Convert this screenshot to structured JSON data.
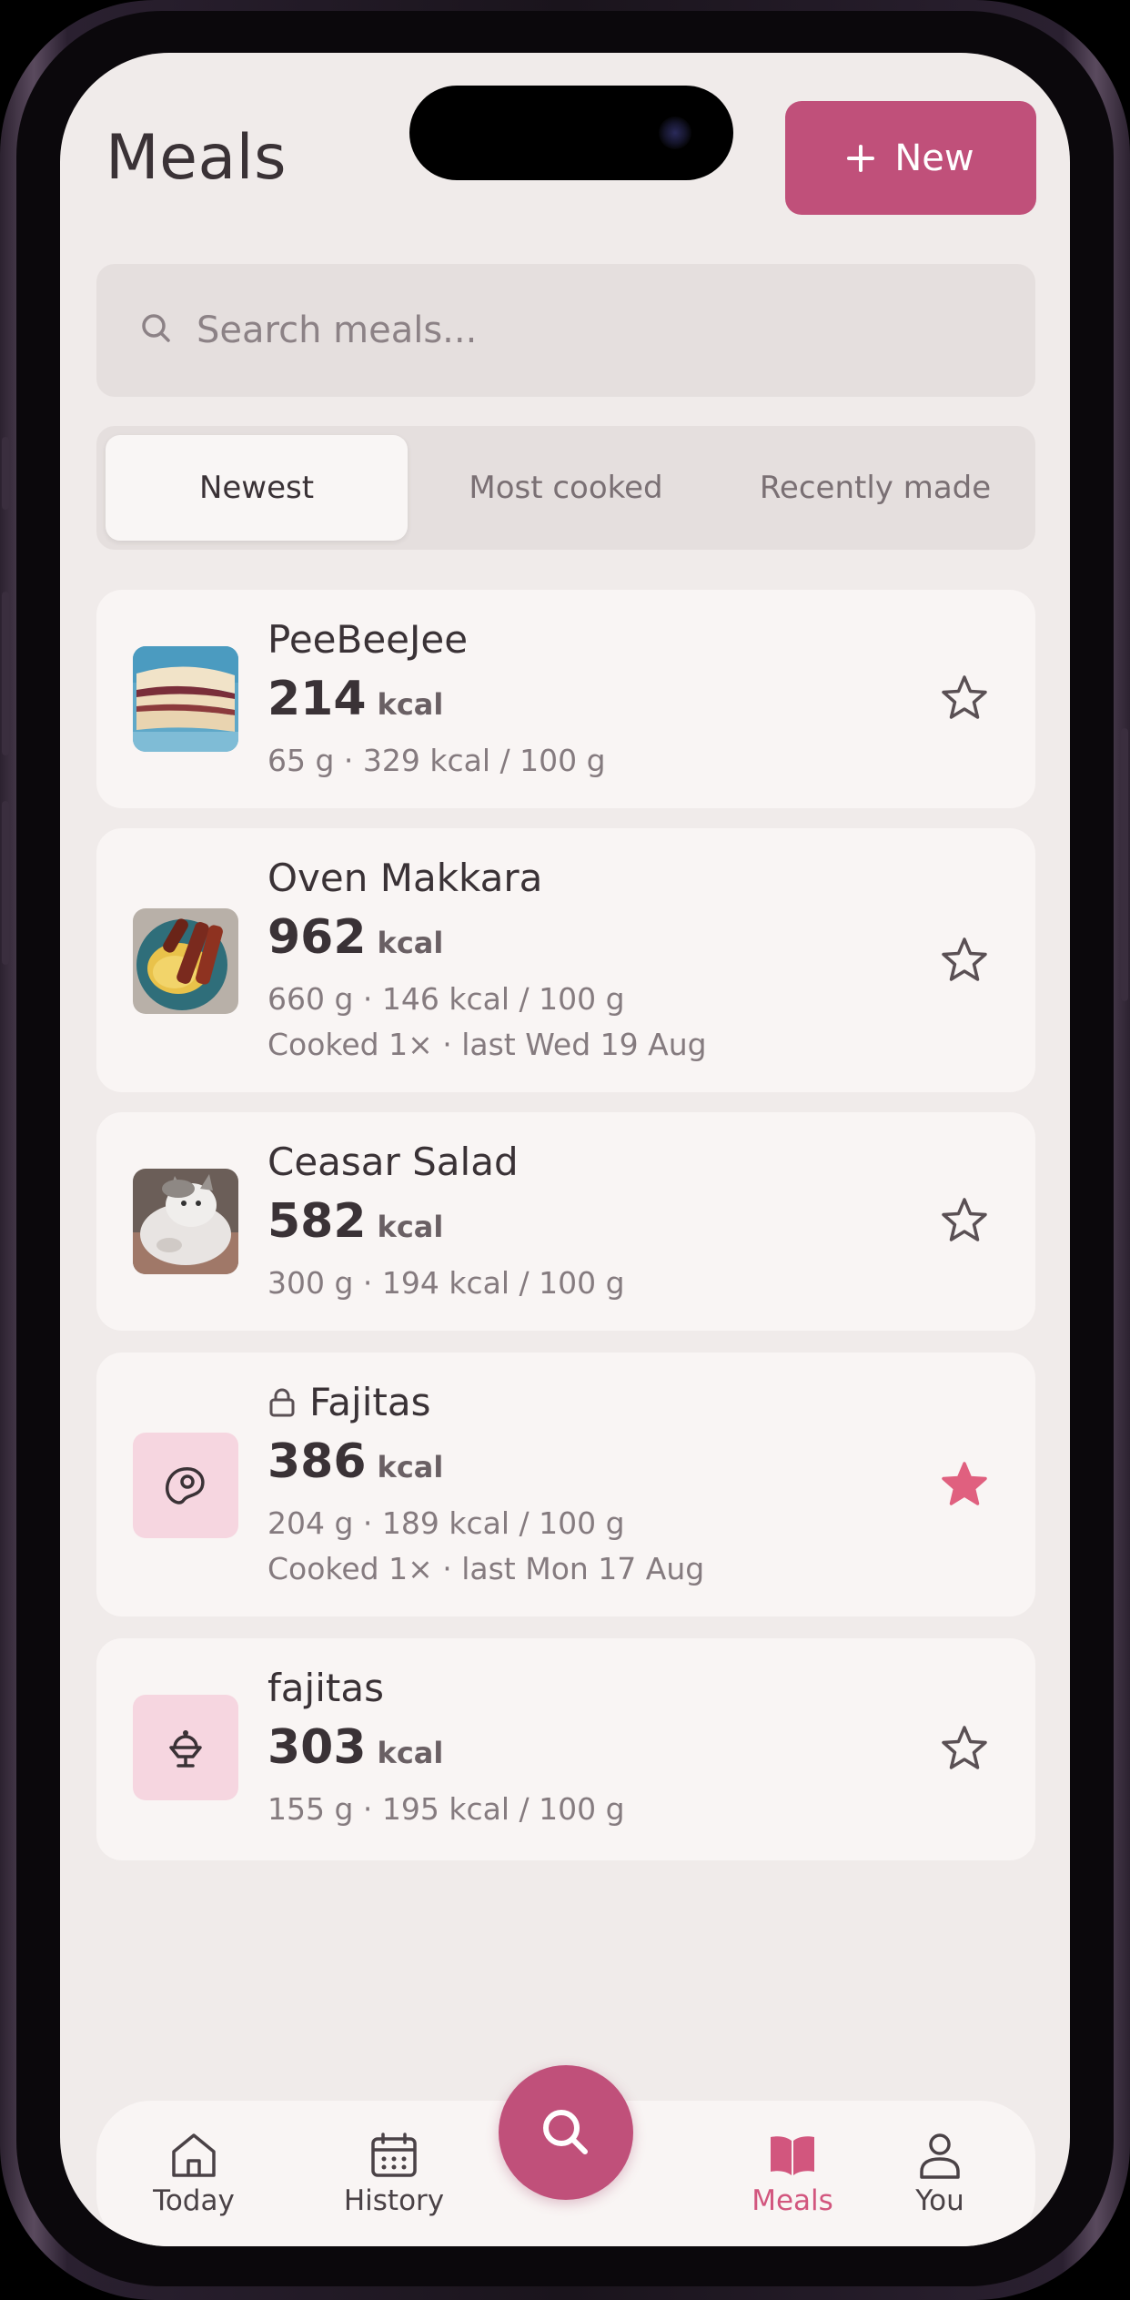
{
  "header": {
    "title": "Meals",
    "new_button_label": "New"
  },
  "search": {
    "placeholder": "Search meals..."
  },
  "sort_tabs": [
    "Newest",
    "Most cooked",
    "Recently made"
  ],
  "meals": [
    {
      "name": "PeeBeeJee",
      "kcal": "214",
      "unit": "kcal",
      "detail": "65 g · 329 kcal / 100 g",
      "cooked": "",
      "starred": false
    },
    {
      "name": "Oven Makkara",
      "kcal": "962",
      "unit": "kcal",
      "detail": "660 g · 146 kcal / 100 g",
      "cooked": "Cooked 1× · last Wed 19 Aug",
      "starred": false
    },
    {
      "name": "Ceasar Salad",
      "kcal": "582",
      "unit": "kcal",
      "detail": "300 g · 194 kcal / 100 g",
      "cooked": "",
      "starred": false
    },
    {
      "name": "Fajitas",
      "kcal": "386",
      "unit": "kcal",
      "detail": "204 g · 189 kcal / 100 g",
      "cooked": "Cooked 1× · last Mon 17 Aug",
      "starred": true,
      "locked": true
    },
    {
      "name": "fajitas",
      "kcal": "303",
      "unit": "kcal",
      "detail": "155 g · 195 kcal / 100 g",
      "cooked": "",
      "starred": false
    }
  ],
  "nav": {
    "today": "Today",
    "history": "History",
    "meals": "Meals",
    "you": "You",
    "active": "Meals"
  },
  "colors": {
    "accent": "#c0507a",
    "active_nav": "#d2567e",
    "star_filled": "#e0607f",
    "background": "#f0ebea"
  },
  "icons": [
    "search-icon",
    "plus-icon",
    "star-icon",
    "lock-icon",
    "meat-icon",
    "sundae-icon",
    "home-icon",
    "calendar-icon",
    "book-icon",
    "person-icon"
  ]
}
